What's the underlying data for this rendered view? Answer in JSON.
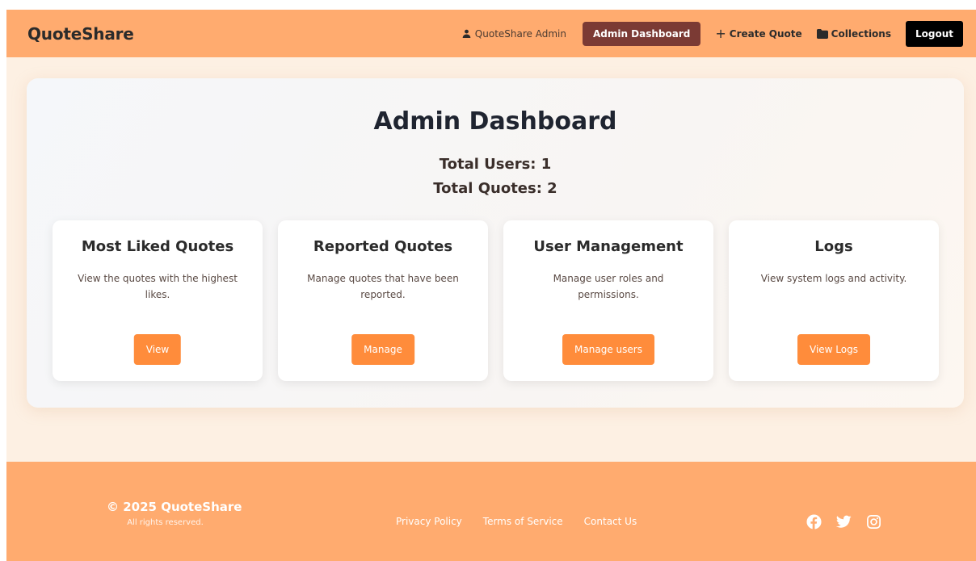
{
  "header": {
    "brand": "QuoteShare",
    "user_label": "QuoteShare Admin",
    "admin_dashboard_label": "Admin Dashboard",
    "create_quote_label": "Create Quote",
    "collections_label": "Collections",
    "logout_label": "Logout"
  },
  "main": {
    "title": "Admin Dashboard",
    "total_users": "Total Users: 1",
    "total_quotes": "Total Quotes: 2",
    "cards": [
      {
        "title": "Most Liked Quotes",
        "description": "View the quotes with the highest likes.",
        "button": "View"
      },
      {
        "title": "Reported Quotes",
        "description": "Manage quotes that have been reported.",
        "button": "Manage"
      },
      {
        "title": "User Management",
        "description": "Manage user roles and permissions.",
        "button": "Manage users"
      },
      {
        "title": "Logs",
        "description": "View system logs and activity.",
        "button": "View Logs"
      }
    ]
  },
  "footer": {
    "copyright": "© 2025 QuoteShare",
    "rights": "All rights reserved.",
    "links": [
      "Privacy Policy",
      "Terms of Service",
      "Contact Us"
    ],
    "social_icons": [
      "facebook-icon",
      "twitter-icon",
      "instagram-icon"
    ]
  },
  "colors": {
    "header_bg": "#ffab6f",
    "admin_button": "#7b3a34",
    "accent_button": "#ff8c3b",
    "logout_button": "#000000"
  }
}
